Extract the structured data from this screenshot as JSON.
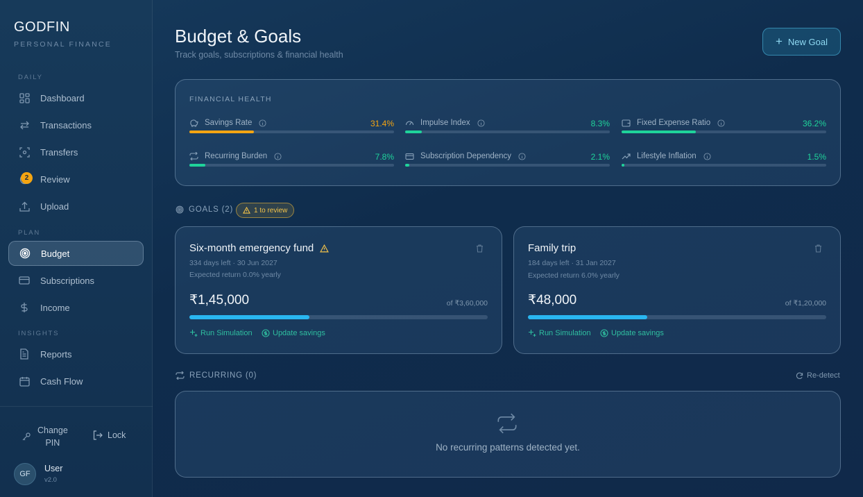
{
  "sidebar": {
    "brand": "GODFIN",
    "brand_sub": "PERSONAL FINANCE",
    "sections": {
      "daily": "DAILY",
      "plan": "PLAN",
      "insights": "INSIGHTS"
    },
    "items": [
      {
        "label": "Dashboard",
        "icon": "dashboard-icon"
      },
      {
        "label": "Transactions",
        "icon": "transactions-icon"
      },
      {
        "label": "Transfers",
        "icon": "transfers-icon"
      },
      {
        "label": "Review",
        "icon": "review-icon",
        "badge": "2"
      },
      {
        "label": "Upload",
        "icon": "upload-icon"
      },
      {
        "label": "Budget",
        "icon": "target-icon",
        "active": true
      },
      {
        "label": "Subscriptions",
        "icon": "card-icon"
      },
      {
        "label": "Income",
        "icon": "dollar-icon"
      },
      {
        "label": "Reports",
        "icon": "report-icon"
      },
      {
        "label": "Cash Flow",
        "icon": "calendar-icon"
      }
    ],
    "footer": {
      "change_pin_line1": "Change",
      "change_pin_line2": "PIN",
      "lock": "Lock"
    },
    "user": {
      "initials": "GF",
      "name": "User",
      "version": "v2.0"
    }
  },
  "header": {
    "title": "Budget & Goals",
    "subtitle": "Track goals, subscriptions & financial health",
    "new_goal": "New Goal"
  },
  "financial_health": {
    "title": "FINANCIAL HEALTH",
    "metrics": [
      {
        "label": "Savings Rate",
        "value": "31.4%",
        "percent": 31.4,
        "color": "#f4a512",
        "icon": "piggy-icon"
      },
      {
        "label": "Impulse Index",
        "value": "8.3%",
        "percent": 8.3,
        "color": "#1fd39a",
        "icon": "gauge-icon"
      },
      {
        "label": "Fixed Expense Ratio",
        "value": "36.2%",
        "percent": 36.2,
        "color": "#1fd39a",
        "icon": "wallet-icon"
      },
      {
        "label": "Recurring Burden",
        "value": "7.8%",
        "percent": 7.8,
        "color": "#1fd39a",
        "icon": "repeat-icon"
      },
      {
        "label": "Subscription Dependency",
        "value": "2.1%",
        "percent": 2.1,
        "color": "#1fd39a",
        "icon": "card-icon"
      },
      {
        "label": "Lifestyle Inflation",
        "value": "1.5%",
        "percent": 1.5,
        "color": "#1fd39a",
        "icon": "trend-up-icon"
      }
    ]
  },
  "goals": {
    "heading": "GOALS (2)",
    "review_pill": "1 to review",
    "items": [
      {
        "title": "Six-month emergency fund",
        "warning": true,
        "days_left": "334 days left · 30 Jun 2027",
        "expected_return": "Expected return 0.0% yearly",
        "amount": "₹1,45,000",
        "target": "of ₹3,60,000",
        "progress": 0.4028,
        "run_simulation": "Run Simulation",
        "update_savings": "Update savings"
      },
      {
        "title": "Family trip",
        "warning": false,
        "days_left": "184 days left · 31 Jan 2027",
        "expected_return": "Expected return 6.0% yearly",
        "amount": "₹48,000",
        "target": "of ₹1,20,000",
        "progress": 0.4,
        "run_simulation": "Run Simulation",
        "update_savings": "Update savings"
      }
    ]
  },
  "recurring": {
    "heading": "RECURRING (0)",
    "redetect": "Re-detect",
    "empty_text": "No recurring patterns detected yet."
  }
}
